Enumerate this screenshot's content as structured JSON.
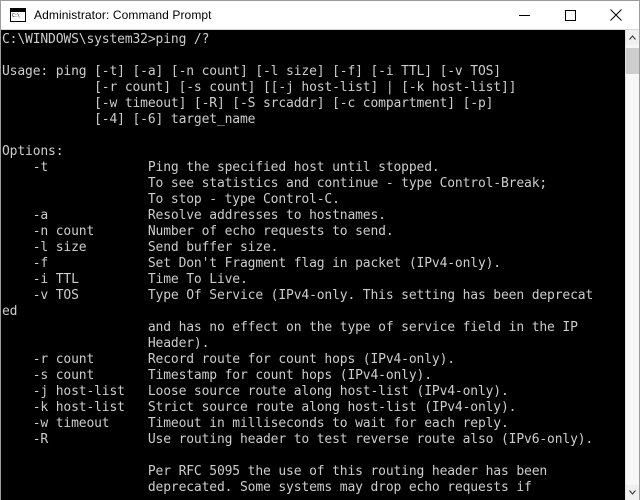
{
  "window": {
    "title": "Administrator: Command Prompt",
    "icon": "console-icon",
    "colors": {
      "titlebar_bg": "#ffffff",
      "titlebar_fg": "#000000",
      "console_bg": "#000000",
      "console_fg": "#cccccc",
      "scrollbar_track": "#f7f7f7",
      "scrollbar_thumb": "#cdcdcd",
      "window_border": "#9b9b9b"
    },
    "caption_buttons": [
      {
        "name": "minimize-button",
        "label": "Minimize"
      },
      {
        "name": "maximize-button",
        "label": "Maximize"
      },
      {
        "name": "close-button",
        "label": "Close"
      }
    ]
  },
  "console": {
    "prompt": "C:\\WINDOWS\\system32>",
    "command": "ping /?",
    "prompt_line": "C:\\WINDOWS\\system32>ping /?",
    "lines": [
      "C:\\WINDOWS\\system32>ping /?",
      "",
      "Usage: ping [-t] [-a] [-n count] [-l size] [-f] [-i TTL] [-v TOS]",
      "            [-r count] [-s count] [[-j host-list] | [-k host-list]]",
      "            [-w timeout] [-R] [-S srcaddr] [-c compartment] [-p]",
      "            [-4] [-6] target_name",
      "",
      "Options:",
      "    -t             Ping the specified host until stopped.",
      "                   To see statistics and continue - type Control-Break;",
      "                   To stop - type Control-C.",
      "    -a             Resolve addresses to hostnames.",
      "    -n count       Number of echo requests to send.",
      "    -l size        Send buffer size.",
      "    -f             Set Don't Fragment flag in packet (IPv4-only).",
      "    -i TTL         Time To Live.",
      "    -v TOS         Type Of Service (IPv4-only. This setting has been deprecat",
      "ed",
      "                   and has no effect on the type of service field in the IP",
      "                   Header).",
      "    -r count       Record route for count hops (IPv4-only).",
      "    -s count       Timestamp for count hops (IPv4-only).",
      "    -j host-list   Loose source route along host-list (IPv4-only).",
      "    -k host-list   Strict source route along host-list (IPv4-only).",
      "    -w timeout     Timeout in milliseconds to wait for each reply.",
      "    -R             Use routing header to test reverse route also (IPv6-only).",
      "",
      "                   Per RFC 5095 the use of this routing header has been",
      "                   deprecated. Some systems may drop echo requests if"
    ],
    "text": "C:\\WINDOWS\\system32>ping /?\n\nUsage: ping [-t] [-a] [-n count] [-l size] [-f] [-i TTL] [-v TOS]\n            [-r count] [-s count] [[-j host-list] | [-k host-list]]\n            [-w timeout] [-R] [-S srcaddr] [-c compartment] [-p]\n            [-4] [-6] target_name\n\nOptions:\n    -t             Ping the specified host until stopped.\n                   To see statistics and continue - type Control-Break;\n                   To stop - type Control-C.\n    -a             Resolve addresses to hostnames.\n    -n count       Number of echo requests to send.\n    -l size        Send buffer size.\n    -f             Set Don't Fragment flag in packet (IPv4-only).\n    -i TTL         Time To Live.\n    -v TOS         Type Of Service (IPv4-only. This setting has been deprecat\ned\n                   and has no effect on the type of service field in the IP\n                   Header).\n    -r count       Record route for count hops (IPv4-only).\n    -s count       Timestamp for count hops (IPv4-only).\n    -j host-list   Loose source route along host-list (IPv4-only).\n    -k host-list   Strict source route along host-list (IPv4-only).\n    -w timeout     Timeout in milliseconds to wait for each reply.\n    -R             Use routing header to test reverse route also (IPv6-only).\n\n                   Per RFC 5095 the use of this routing header has been\n                   deprecated. Some systems may drop echo requests if"
  },
  "scrollbar": {
    "up_arrow": "scroll-up-icon",
    "down_arrow": "scroll-down-icon"
  }
}
